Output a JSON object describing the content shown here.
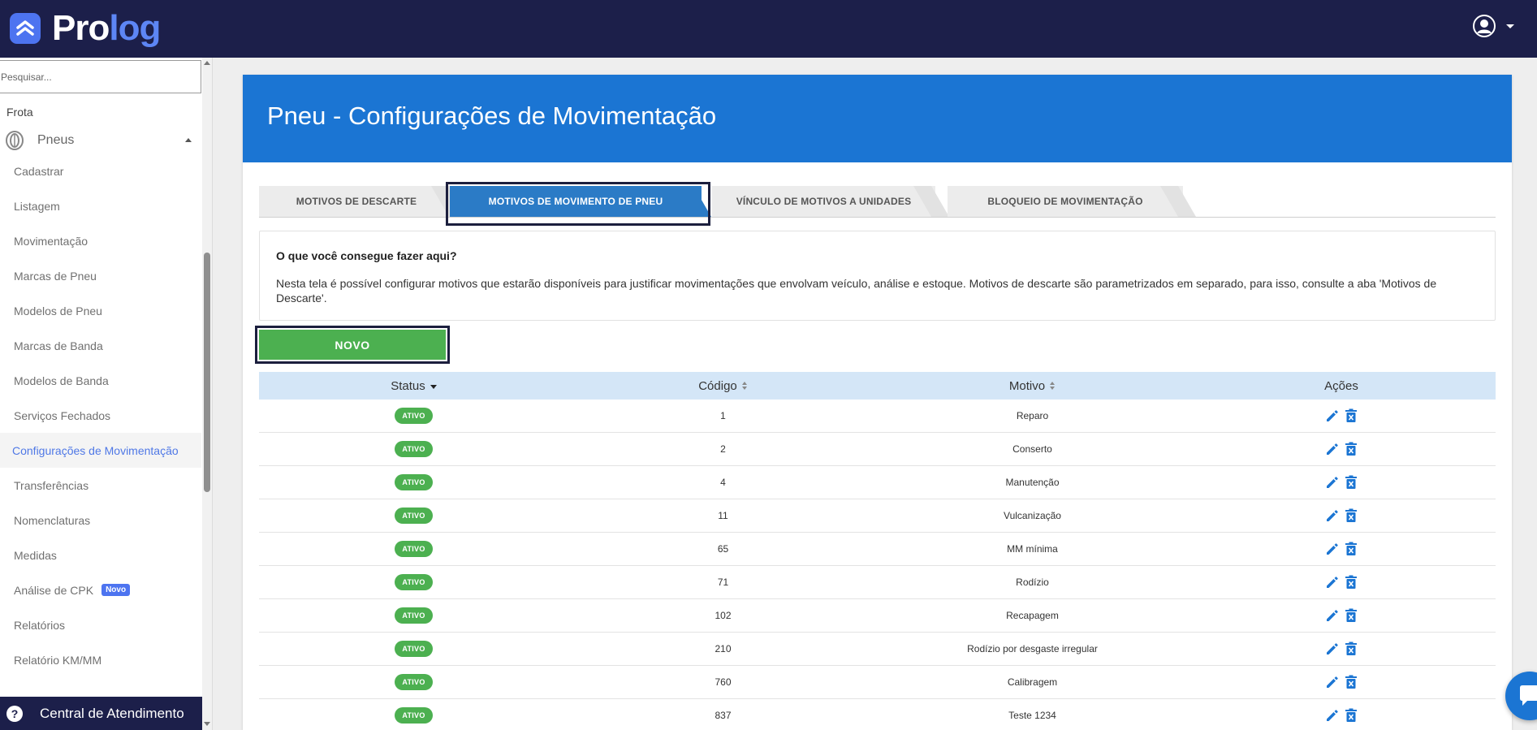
{
  "app": {
    "logo_text_primary": "Pro",
    "logo_text_accent": "log",
    "brand_color": "#1c1f4a",
    "accent_color": "#4d74f0"
  },
  "topbar": {
    "user_icon": "user-circle-icon"
  },
  "sidebar": {
    "search_placeholder": "Pesquisar...",
    "section_label": "Frota",
    "group_label": "Pneus",
    "items": [
      {
        "label": "Cadastrar"
      },
      {
        "label": "Listagem"
      },
      {
        "label": "Movimentação"
      },
      {
        "label": "Marcas de Pneu"
      },
      {
        "label": "Modelos de Pneu"
      },
      {
        "label": "Marcas de Banda"
      },
      {
        "label": "Modelos de Banda"
      },
      {
        "label": "Serviços Fechados"
      },
      {
        "label": "Configurações de Movimentação",
        "active": true
      },
      {
        "label": "Transferências"
      },
      {
        "label": "Nomenclaturas"
      },
      {
        "label": "Medidas"
      },
      {
        "label": "Análise de CPK",
        "badge": "Novo"
      },
      {
        "label": "Relatórios"
      },
      {
        "label": "Relatório KM/MM"
      }
    ],
    "help_label": "Central de Atendimento"
  },
  "page": {
    "title": "Pneu - Configurações de Movimentação",
    "tabs": [
      {
        "label": "MOTIVOS DE DESCARTE"
      },
      {
        "label": "MOTIVOS DE MOVIMENTO DE PNEU",
        "active": true
      },
      {
        "label": "VÍNCULO DE MOTIVOS A UNIDADES"
      },
      {
        "label": "BLOQUEIO DE MOVIMENTAÇÃO"
      }
    ],
    "info_title": "O que você consegue fazer aqui?",
    "info_text": "Nesta tela é possível configurar motivos que estarão disponíveis para justificar movimentações que envolvam veículo, análise e estoque. Motivos de descarte são parametrizados em separado, para isso, consulte a aba 'Motivos de Descarte'.",
    "new_button": "NOVO",
    "table": {
      "columns": [
        "Status",
        "Código",
        "Motivo",
        "Ações"
      ],
      "rows": [
        {
          "status": "ATIVO",
          "code": "1",
          "reason": "Reparo"
        },
        {
          "status": "ATIVO",
          "code": "2",
          "reason": "Conserto"
        },
        {
          "status": "ATIVO",
          "code": "4",
          "reason": "Manutenção"
        },
        {
          "status": "ATIVO",
          "code": "11",
          "reason": "Vulcanização"
        },
        {
          "status": "ATIVO",
          "code": "65",
          "reason": "MM mínima"
        },
        {
          "status": "ATIVO",
          "code": "71",
          "reason": "Rodízio"
        },
        {
          "status": "ATIVO",
          "code": "102",
          "reason": "Recapagem"
        },
        {
          "status": "ATIVO",
          "code": "210",
          "reason": "Rodízio por desgaste irregular"
        },
        {
          "status": "ATIVO",
          "code": "760",
          "reason": "Calibragem"
        },
        {
          "status": "ATIVO",
          "code": "837",
          "reason": "Teste 1234"
        }
      ]
    }
  }
}
